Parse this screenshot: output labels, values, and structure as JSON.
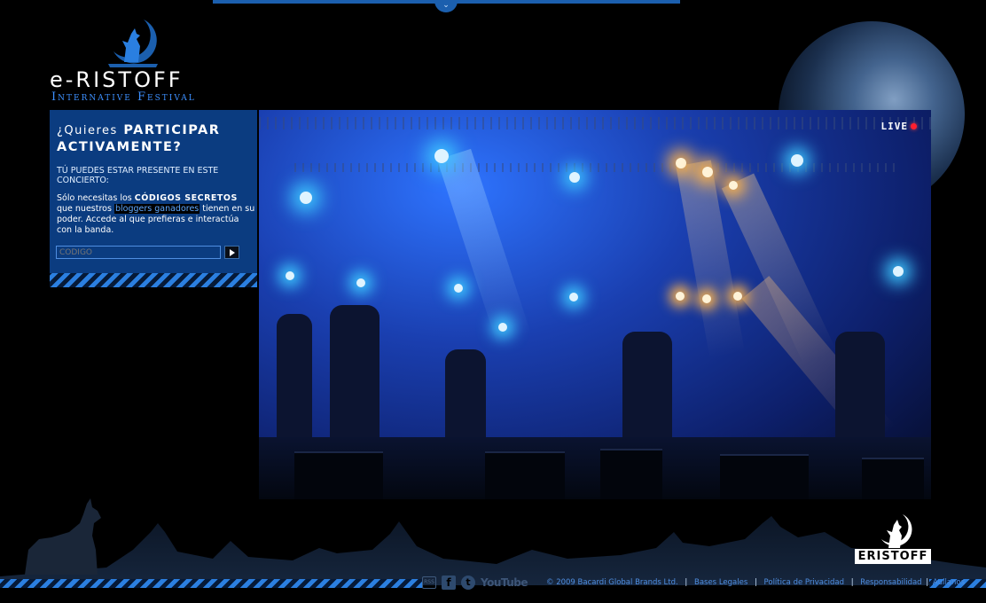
{
  "logo": {
    "name": "e-RISTOFF",
    "subtitle": "Internative Festival"
  },
  "panel": {
    "title_prefix": "¿Quieres",
    "title_main": "PARTICIPAR ACTIVAMENTE?",
    "lead": "TÚ PUEDES ESTAR PRESENTE EN ESTE CONCIERTO:",
    "text_1": "Sólo necesitas los",
    "text_bold": "CÓDIGOS SECRETOS",
    "text_2": "que nuestros",
    "text_highlight": "bloggers ganadores",
    "text_3": "tienen en su poder. Accede al que prefieras e interactúa con la banda.",
    "code_placeholder": "CODIGO"
  },
  "stage": {
    "live_label": "LIVE"
  },
  "badge": {
    "label": "ERISTOFF"
  },
  "social": {
    "rss": "RSS",
    "facebook": "f",
    "twitter": "t",
    "youtube": "YouTube"
  },
  "footer": {
    "copyright": "© 2009 Bacardi Global Brands Ltd.",
    "links": [
      "Bases Legales",
      "Política de Privacidad",
      "Responsabilidad",
      "Aullanos"
    ]
  },
  "colors": {
    "accent": "#1b5fae",
    "panel_bg": "#0b3c80",
    "link": "#4f8ee0",
    "live": "#ff1f2f"
  }
}
